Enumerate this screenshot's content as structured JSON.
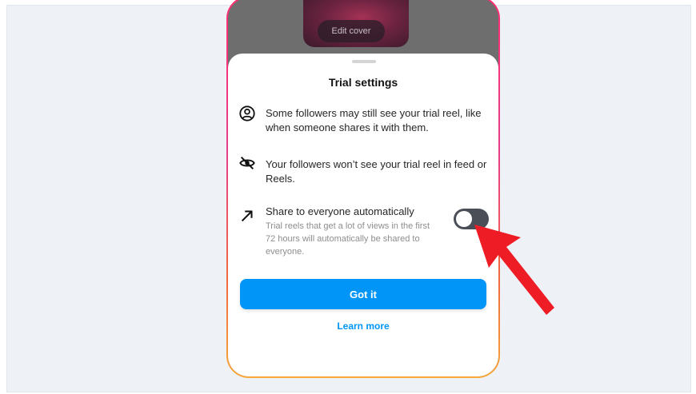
{
  "cover": {
    "edit_label": "Edit cover"
  },
  "sheet": {
    "title": "Trial settings",
    "items": [
      {
        "icon": "user-circle-icon",
        "text": "Some followers may still see your trial reel, like when someone shares it with them."
      },
      {
        "icon": "eye-off-icon",
        "text": "Your followers won’t see your trial reel in feed or Reels."
      },
      {
        "icon": "arrow-up-right-icon",
        "text": "Share to everyone automatically",
        "subtext": "Trial reels that get a lot of views in the first 72 hours will automatically be shared to everyone.",
        "toggle_on": false
      }
    ],
    "primary_button": "Got it",
    "secondary_link": "Learn more"
  },
  "colors": {
    "accent": "#0095f6",
    "toggle_off": "#4a4f57",
    "annotation_arrow": "#ee1c25",
    "phone_border_top": "#ff2d6f",
    "phone_border_bottom": "#f8a838"
  }
}
